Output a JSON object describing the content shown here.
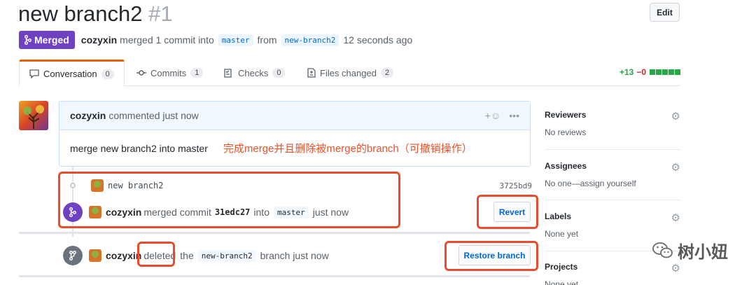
{
  "pr": {
    "title": "new branch2",
    "number": "#1",
    "edit_label": "Edit",
    "state_label": "Merged",
    "author": "cozyxin",
    "merged_text": "merged 1 commit into",
    "base_branch": "master",
    "from_text": "from",
    "head_branch": "new-branch2",
    "time_text": "12 seconds ago"
  },
  "tabs": [
    {
      "label": "Conversation",
      "count": "0"
    },
    {
      "label": "Commits",
      "count": "1"
    },
    {
      "label": "Checks",
      "count": "0"
    },
    {
      "label": "Files changed",
      "count": "2"
    }
  ],
  "diffstat": {
    "additions": "+13",
    "deletions": "−0"
  },
  "comment": {
    "author": "cozyxin",
    "meta": "commented just now",
    "body": "merge new branch2 into master",
    "annotation": "完成merge并且删除被merge的branch（可撤销操作）"
  },
  "commit": {
    "message": "new branch2",
    "sha": "3725bd9"
  },
  "merge_event": {
    "author": "cozyxin",
    "text1": "merged commit",
    "commit": "31edc27",
    "text2": "into",
    "branch": "master",
    "time": "just now",
    "button": "Revert"
  },
  "delete_event": {
    "author": "cozyxin",
    "verb": "deleted",
    "text1": "the",
    "branch": "new-branch2",
    "text2": "branch just now",
    "button": "Restore branch"
  },
  "sidebar": {
    "reviewers": {
      "heading": "Reviewers",
      "value": "No reviews"
    },
    "assignees": {
      "heading": "Assignees",
      "value": "No one—assign yourself"
    },
    "labels": {
      "heading": "Labels",
      "value": "None yet"
    },
    "projects": {
      "heading": "Projects",
      "value": "None yet"
    }
  },
  "watermark": "树小妞",
  "colors": {
    "merged": "#6f42c1",
    "annotation": "#e8522b",
    "add": "#28a745",
    "del": "#cb2431"
  }
}
